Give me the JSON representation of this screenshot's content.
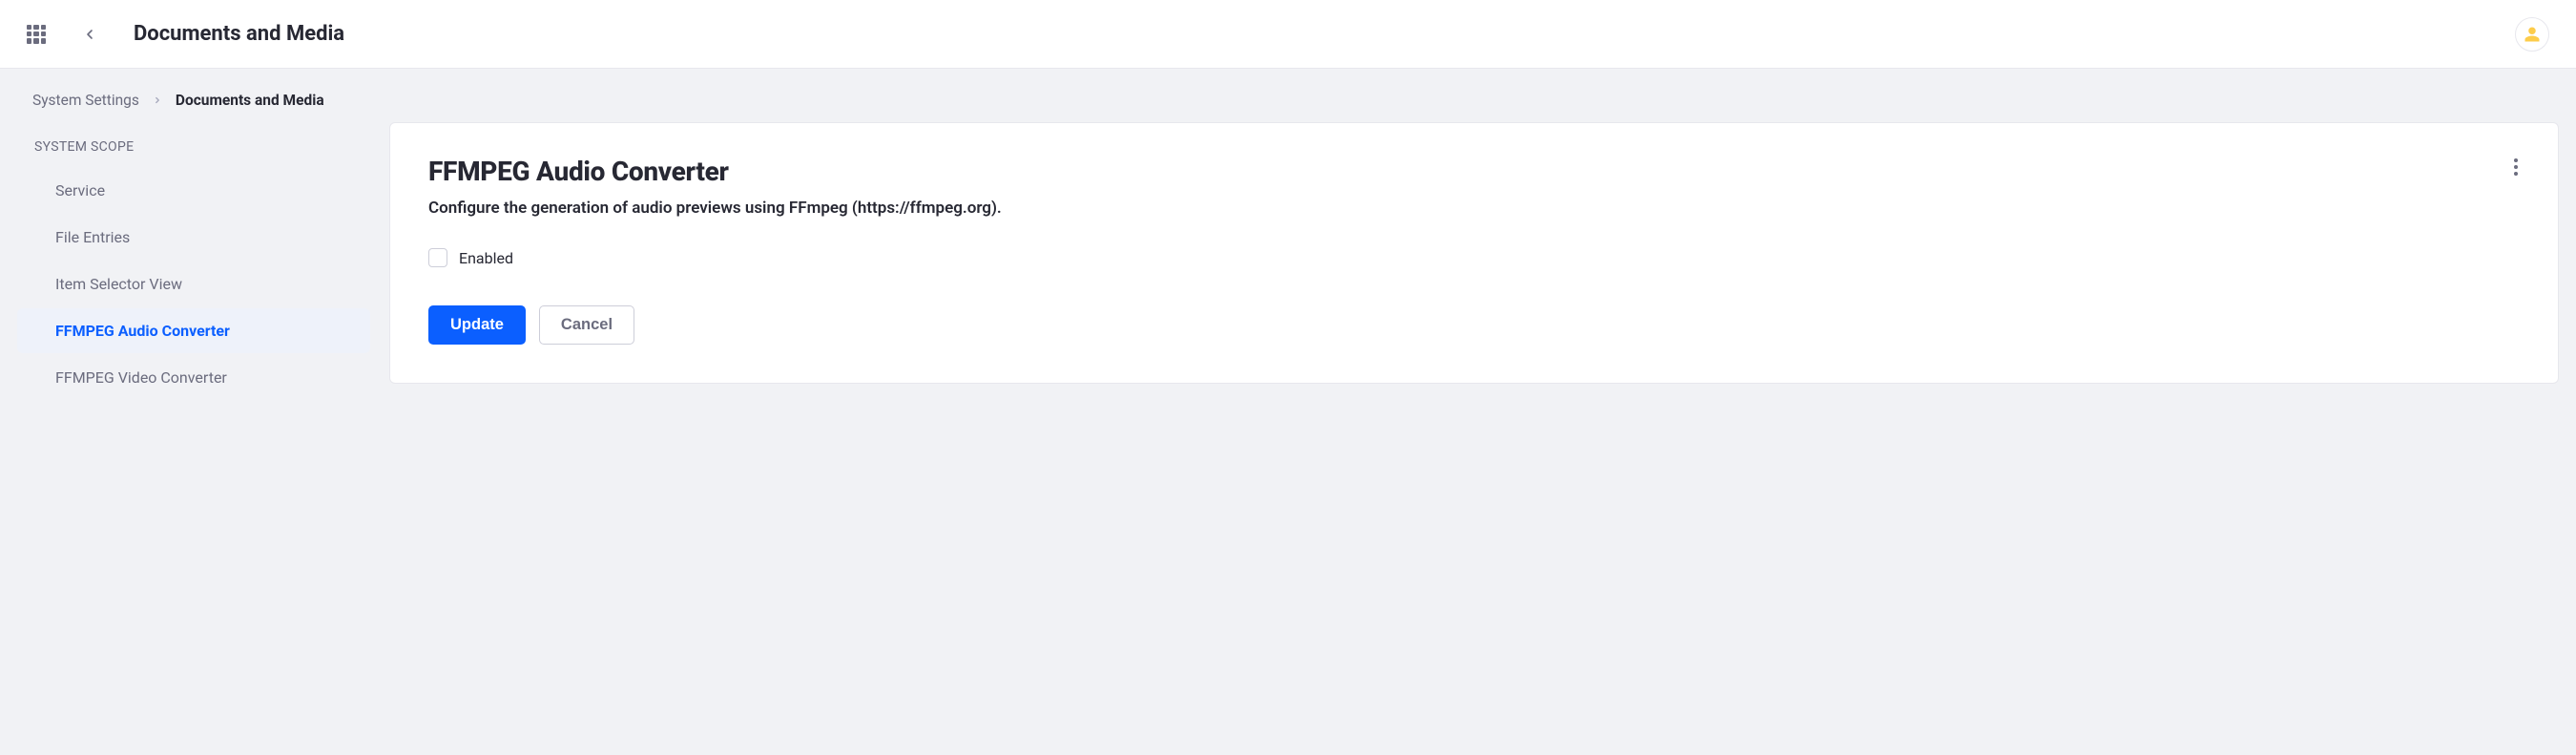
{
  "header": {
    "title": "Documents and Media"
  },
  "breadcrumb": {
    "parent": "System Settings",
    "current": "Documents and Media"
  },
  "sidebar": {
    "scope_label": "SYSTEM SCOPE",
    "items": [
      {
        "label": "Service",
        "active": false
      },
      {
        "label": "File Entries",
        "active": false
      },
      {
        "label": "Item Selector View",
        "active": false
      },
      {
        "label": "FFMPEG Audio Converter",
        "active": true
      },
      {
        "label": "FFMPEG Video Converter",
        "active": false
      }
    ]
  },
  "panel": {
    "title": "FFMPEG Audio Converter",
    "subtitle": "Configure the generation of audio previews using FFmpeg (https://ffmpeg.org).",
    "enabled_label": "Enabled",
    "enabled_checked": false,
    "update_label": "Update",
    "cancel_label": "Cancel"
  }
}
